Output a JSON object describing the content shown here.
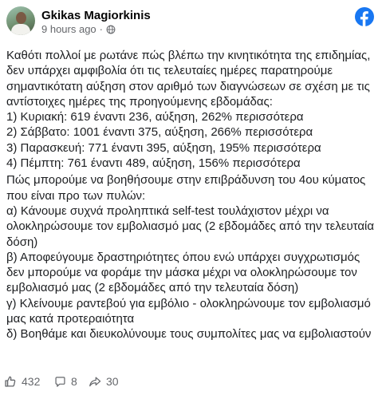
{
  "post": {
    "author": "Gkikas Magiorkinis",
    "timestamp": "9 hours ago",
    "audience_icon": "globe-icon",
    "paragraphs": [
      "Καθότι πολλοί με ρωτάνε πώς βλέπω την κινητικότητα της επιδημίας, δεν υπάρχει αμφιβολία ότι τις τελευταίες ημέρες παρατηρούμε σημαντικότατη αύξηση στον αριθμό των διαγνώσεων σε σχέση με τις αντίστοιχες ημέρες της προηγούμενης εβδομάδας:",
      "1) Κυριακή: 619 έναντι 236, αύξηση, 262% περισσότερα",
      "2) Σάββατο: 1001 έναντι 375, αύξηση, 266% περισσότερα",
      "3) Παρασκευή: 771 έναντι 395, αύξηση, 195% περισσότερα",
      "4) Πέμπτη: 761 έναντι 489, αύξηση, 156% περισσότερα",
      "Πώς μπορούμε να βοηθήσουμε στην επιβράδυνση του 4ου κύματος που είναι προ των πυλών:",
      "α) Κάνουμε συχνά προληπτικά self-test τουλάχιστον μέχρι να ολοκληρώσουμε τον εμβολιασμό μας (2 εβδομάδες από την τελευταία δόση)",
      "β) Αποφεύγουμε δραστηριότητες όπου ενώ υπάρχει συγχρωτισμός δεν μπορούμε να φοράμε την μάσκα μέχρι να ολοκληρώσουμε τον εμβολιασμό μας (2 εβδομάδες από την τελευταία δόση)",
      "γ) Κλείνουμε ραντεβού για εμβόλιο - ολοκληρώνουμε τον εμβολιασμό μας κατά προτεραιότητα",
      "δ) Βοηθάμε και διευκολύνουμε τους συμπολίτες μας να εμβολιαστούν"
    ]
  },
  "stats": {
    "likes": "432",
    "comments": "8",
    "shares": "30"
  },
  "colors": {
    "facebook_blue": "#1877f2",
    "text": "#1c1e21",
    "secondary": "#65676b"
  }
}
